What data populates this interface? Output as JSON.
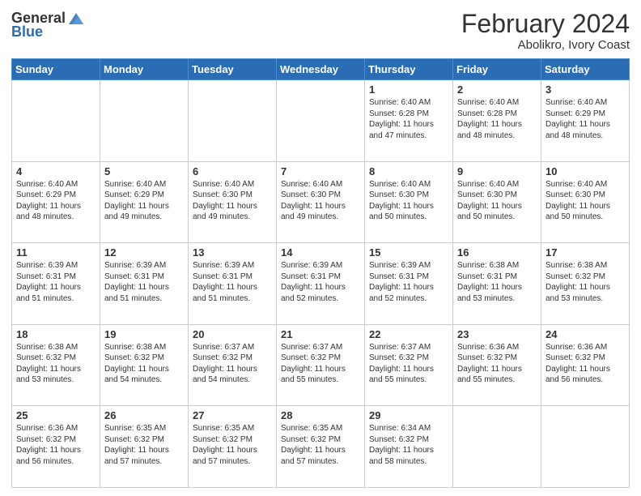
{
  "header": {
    "logo_general": "General",
    "logo_blue": "Blue",
    "month_title": "February 2024",
    "location": "Abolikro, Ivory Coast"
  },
  "days_of_week": [
    "Sunday",
    "Monday",
    "Tuesday",
    "Wednesday",
    "Thursday",
    "Friday",
    "Saturday"
  ],
  "weeks": [
    [
      {
        "day": "",
        "info": ""
      },
      {
        "day": "",
        "info": ""
      },
      {
        "day": "",
        "info": ""
      },
      {
        "day": "",
        "info": ""
      },
      {
        "day": "1",
        "info": "Sunrise: 6:40 AM\nSunset: 6:28 PM\nDaylight: 11 hours\nand 47 minutes."
      },
      {
        "day": "2",
        "info": "Sunrise: 6:40 AM\nSunset: 6:28 PM\nDaylight: 11 hours\nand 48 minutes."
      },
      {
        "day": "3",
        "info": "Sunrise: 6:40 AM\nSunset: 6:29 PM\nDaylight: 11 hours\nand 48 minutes."
      }
    ],
    [
      {
        "day": "4",
        "info": "Sunrise: 6:40 AM\nSunset: 6:29 PM\nDaylight: 11 hours\nand 48 minutes."
      },
      {
        "day": "5",
        "info": "Sunrise: 6:40 AM\nSunset: 6:29 PM\nDaylight: 11 hours\nand 49 minutes."
      },
      {
        "day": "6",
        "info": "Sunrise: 6:40 AM\nSunset: 6:30 PM\nDaylight: 11 hours\nand 49 minutes."
      },
      {
        "day": "7",
        "info": "Sunrise: 6:40 AM\nSunset: 6:30 PM\nDaylight: 11 hours\nand 49 minutes."
      },
      {
        "day": "8",
        "info": "Sunrise: 6:40 AM\nSunset: 6:30 PM\nDaylight: 11 hours\nand 50 minutes."
      },
      {
        "day": "9",
        "info": "Sunrise: 6:40 AM\nSunset: 6:30 PM\nDaylight: 11 hours\nand 50 minutes."
      },
      {
        "day": "10",
        "info": "Sunrise: 6:40 AM\nSunset: 6:30 PM\nDaylight: 11 hours\nand 50 minutes."
      }
    ],
    [
      {
        "day": "11",
        "info": "Sunrise: 6:39 AM\nSunset: 6:31 PM\nDaylight: 11 hours\nand 51 minutes."
      },
      {
        "day": "12",
        "info": "Sunrise: 6:39 AM\nSunset: 6:31 PM\nDaylight: 11 hours\nand 51 minutes."
      },
      {
        "day": "13",
        "info": "Sunrise: 6:39 AM\nSunset: 6:31 PM\nDaylight: 11 hours\nand 51 minutes."
      },
      {
        "day": "14",
        "info": "Sunrise: 6:39 AM\nSunset: 6:31 PM\nDaylight: 11 hours\nand 52 minutes."
      },
      {
        "day": "15",
        "info": "Sunrise: 6:39 AM\nSunset: 6:31 PM\nDaylight: 11 hours\nand 52 minutes."
      },
      {
        "day": "16",
        "info": "Sunrise: 6:38 AM\nSunset: 6:31 PM\nDaylight: 11 hours\nand 53 minutes."
      },
      {
        "day": "17",
        "info": "Sunrise: 6:38 AM\nSunset: 6:32 PM\nDaylight: 11 hours\nand 53 minutes."
      }
    ],
    [
      {
        "day": "18",
        "info": "Sunrise: 6:38 AM\nSunset: 6:32 PM\nDaylight: 11 hours\nand 53 minutes."
      },
      {
        "day": "19",
        "info": "Sunrise: 6:38 AM\nSunset: 6:32 PM\nDaylight: 11 hours\nand 54 minutes."
      },
      {
        "day": "20",
        "info": "Sunrise: 6:37 AM\nSunset: 6:32 PM\nDaylight: 11 hours\nand 54 minutes."
      },
      {
        "day": "21",
        "info": "Sunrise: 6:37 AM\nSunset: 6:32 PM\nDaylight: 11 hours\nand 55 minutes."
      },
      {
        "day": "22",
        "info": "Sunrise: 6:37 AM\nSunset: 6:32 PM\nDaylight: 11 hours\nand 55 minutes."
      },
      {
        "day": "23",
        "info": "Sunrise: 6:36 AM\nSunset: 6:32 PM\nDaylight: 11 hours\nand 55 minutes."
      },
      {
        "day": "24",
        "info": "Sunrise: 6:36 AM\nSunset: 6:32 PM\nDaylight: 11 hours\nand 56 minutes."
      }
    ],
    [
      {
        "day": "25",
        "info": "Sunrise: 6:36 AM\nSunset: 6:32 PM\nDaylight: 11 hours\nand 56 minutes."
      },
      {
        "day": "26",
        "info": "Sunrise: 6:35 AM\nSunset: 6:32 PM\nDaylight: 11 hours\nand 57 minutes."
      },
      {
        "day": "27",
        "info": "Sunrise: 6:35 AM\nSunset: 6:32 PM\nDaylight: 11 hours\nand 57 minutes."
      },
      {
        "day": "28",
        "info": "Sunrise: 6:35 AM\nSunset: 6:32 PM\nDaylight: 11 hours\nand 57 minutes."
      },
      {
        "day": "29",
        "info": "Sunrise: 6:34 AM\nSunset: 6:32 PM\nDaylight: 11 hours\nand 58 minutes."
      },
      {
        "day": "",
        "info": ""
      },
      {
        "day": "",
        "info": ""
      }
    ]
  ]
}
